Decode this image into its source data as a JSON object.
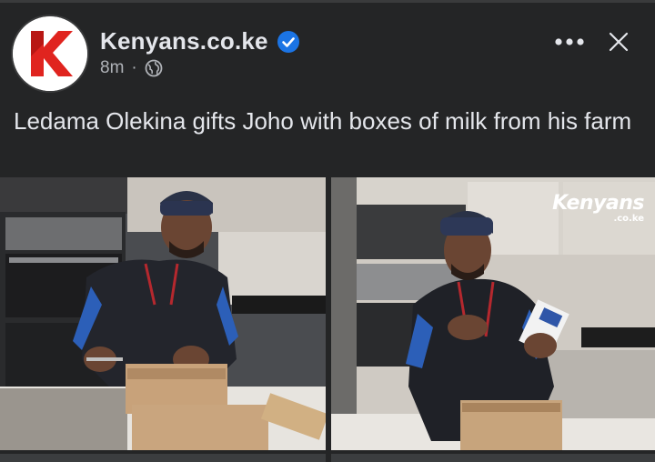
{
  "header": {
    "page_name": "Kenyans.co.ke",
    "timestamp": "8m",
    "separator": "·",
    "avatar_logo_letter": "K",
    "verified_icon": "verified-badge-icon",
    "privacy_icon": "globe-icon",
    "more_icon": "more-dots-icon",
    "close_icon": "close-icon"
  },
  "post": {
    "text": "Ledama Olekina gifts Joho with boxes of milk from his farm"
  },
  "photos": {
    "watermark_main": "Kenyans",
    "watermark_sub": ".co.ke"
  },
  "colors": {
    "background": "#242526",
    "verified_blue": "#1b74e4",
    "logo_red": "#e0241f"
  }
}
